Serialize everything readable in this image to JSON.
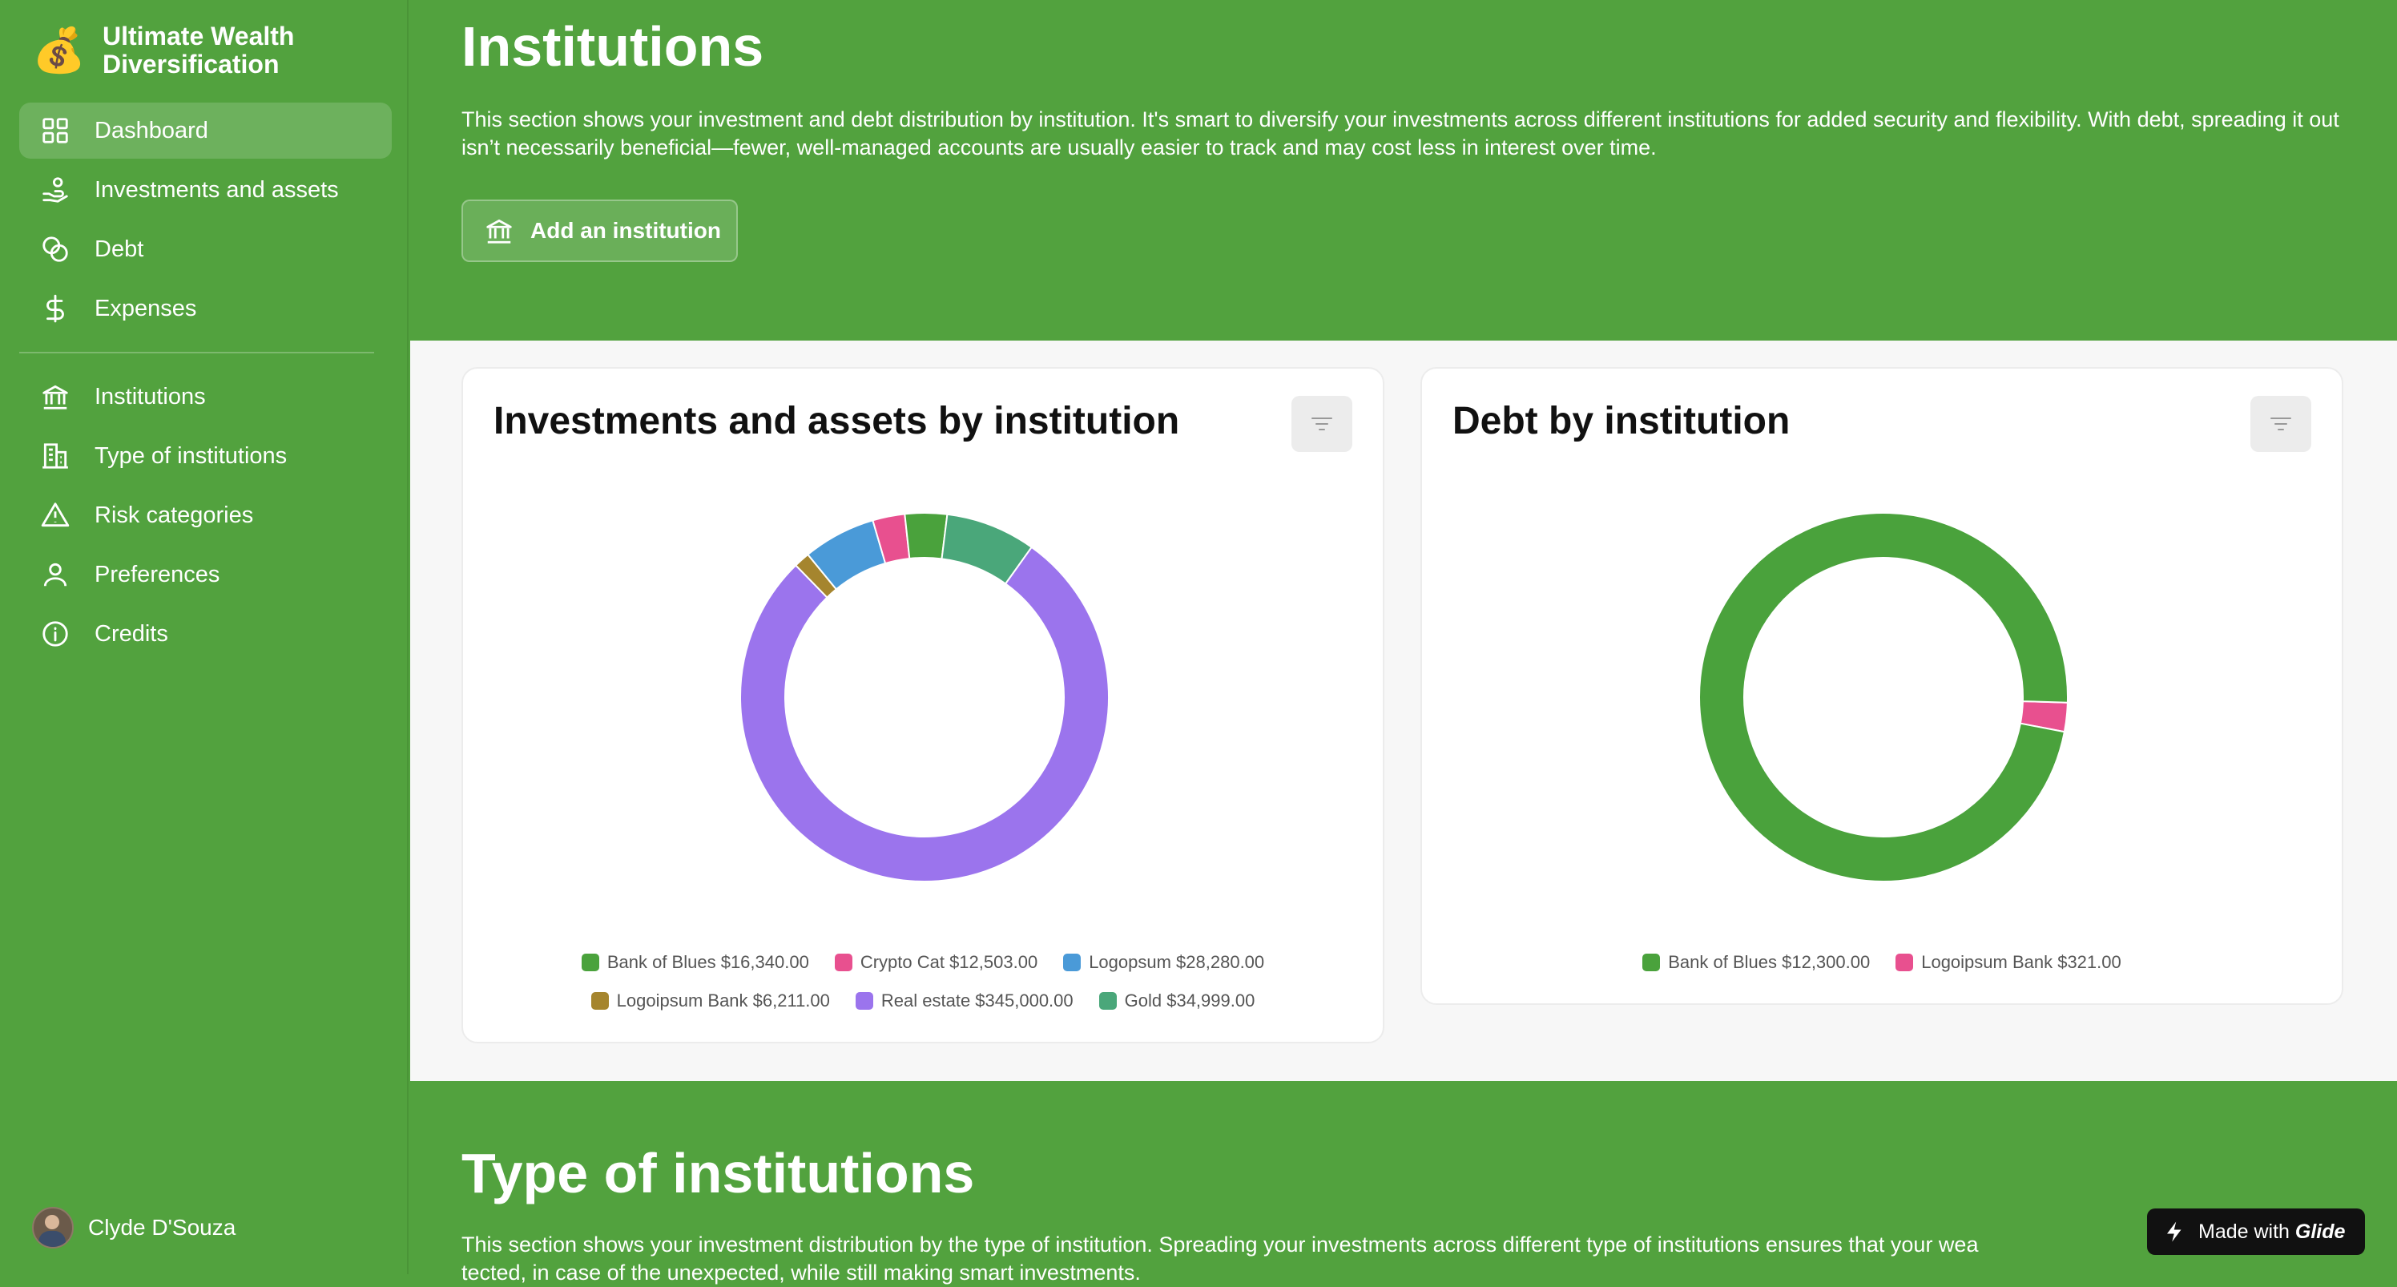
{
  "app": {
    "icon": "money-bag-icon",
    "title": "Ultimate Wealth Diversification",
    "title_line1": "Ultimate Wealth",
    "title_line2": "Diversification"
  },
  "sidebar": {
    "items": [
      {
        "label": "Dashboard",
        "icon": "dashboard-icon",
        "active": true
      },
      {
        "label": "Investments and assets",
        "icon": "hand-coins-icon"
      },
      {
        "label": "Debt",
        "icon": "coins-icon"
      },
      {
        "label": "Expenses",
        "icon": "dollar-icon"
      },
      {
        "label": "Institutions",
        "icon": "bank-icon"
      },
      {
        "label": "Type of institutions",
        "icon": "building-icon"
      },
      {
        "label": "Risk categories",
        "icon": "warning-icon"
      },
      {
        "label": "Preferences",
        "icon": "user-icon"
      },
      {
        "label": "Credits",
        "icon": "info-icon"
      }
    ],
    "user": {
      "name": "Clyde D'Souza"
    }
  },
  "section1": {
    "title": "Institutions",
    "description": "This section shows your investment and debt distribution by institution. It's smart to diversify your investments across different institutions for added security and flexibility. With debt, spreading it out isn’t necessarily beneficial—fewer, well-managed accounts are usually easier to track and may cost less in interest over time.",
    "add_button": "Add an institution"
  },
  "section2": {
    "title": "Type of institutions",
    "description_line1": "This section shows your investment distribution by the type of institution. Spreading your investments across different type of institutions ensures that your wea",
    "description_line2": "tected, in case of the unexpected, while still making smart investments."
  },
  "glide_badge": {
    "prefix": "Made with",
    "brand": "Glide"
  },
  "chart_data": [
    {
      "type": "pie",
      "title": "Investments and assets by institution",
      "donut": true,
      "categories": [
        "Bank of Blues",
        "Crypto Cat",
        "Logopsum",
        "Logoipsum Bank",
        "Real estate",
        "Gold"
      ],
      "values": [
        16340,
        12503,
        28280,
        6211,
        345000,
        34999
      ],
      "legend_labels": [
        "Bank of Blues $16,340.00",
        "Crypto Cat $12,503.00",
        "Logopsum $28,280.00",
        "Logoipsum Bank $6,211.00",
        "Real estate $345,000.00",
        "Gold $34,999.00"
      ],
      "colors": [
        "#4aa23c",
        "#e8508f",
        "#4a9ad8",
        "#a5852e",
        "#9b74ed",
        "#4aa77a"
      ],
      "draw_order": [
        4,
        3,
        2,
        1,
        0,
        5
      ],
      "legend": "bottom"
    },
    {
      "type": "pie",
      "title": "Debt by institution",
      "donut": true,
      "categories": [
        "Bank of Blues",
        "Logoipsum Bank"
      ],
      "values": [
        12300,
        321
      ],
      "legend_labels": [
        "Bank of Blues $12,300.00",
        "Logoipsum Bank $321.00"
      ],
      "colors": [
        "#4aa23c",
        "#e8508f"
      ],
      "draw_order": [
        1,
        0
      ],
      "legend": "bottom"
    }
  ]
}
